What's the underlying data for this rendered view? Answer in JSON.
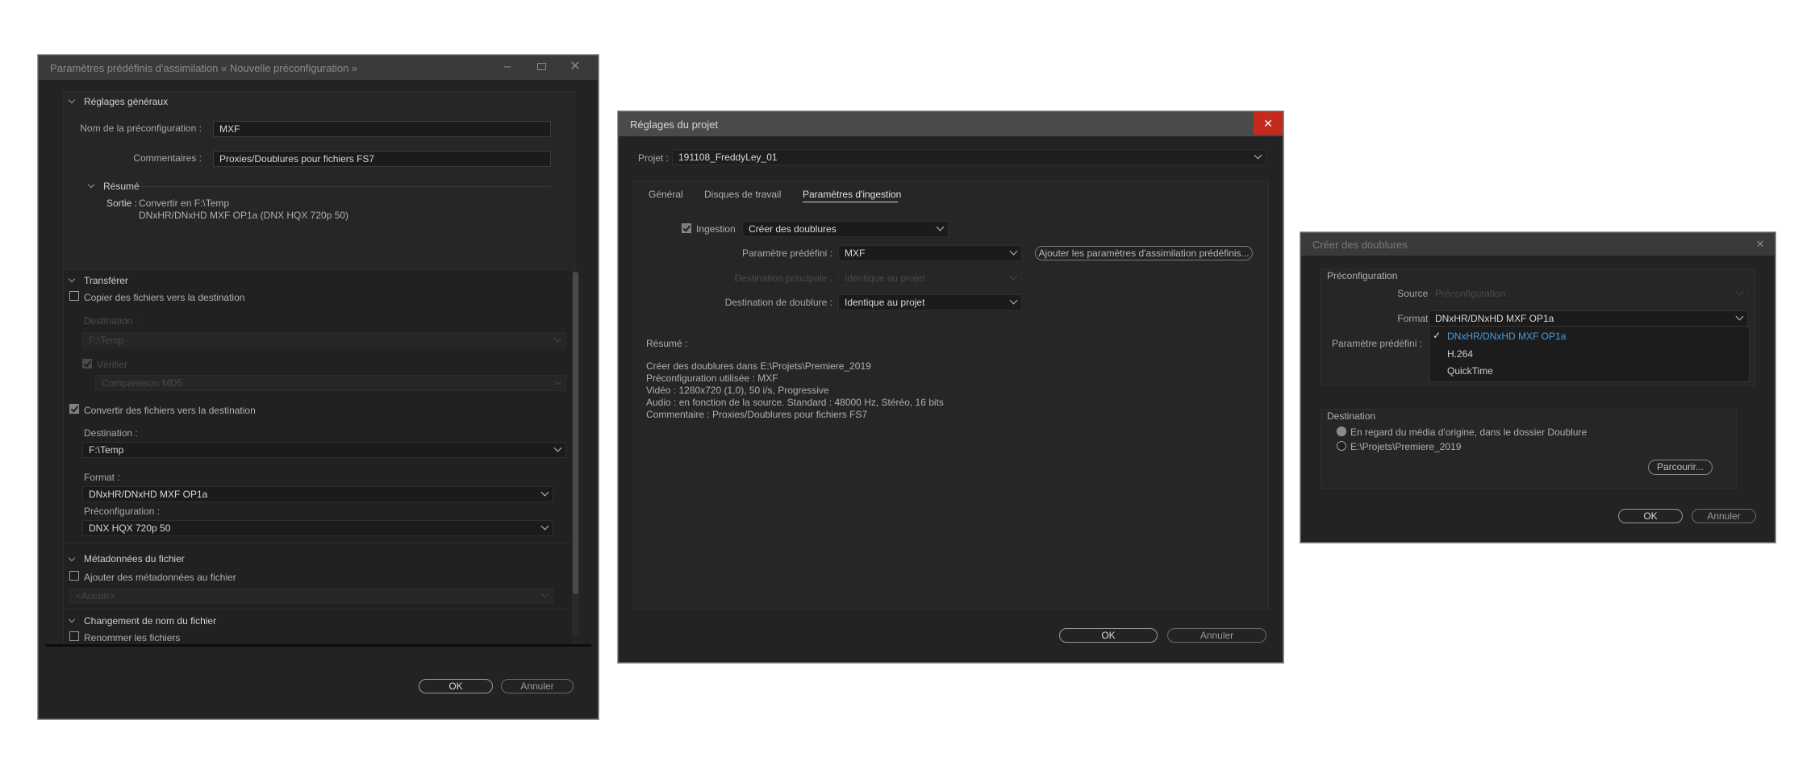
{
  "w1": {
    "title": "Paramètres prédéfinis d'assimilation « Nouvelle préconfiguration »",
    "general": {
      "header": "Réglages généraux",
      "name_label": "Nom de la préconfiguration :",
      "name_value": "MXF",
      "comments_label": "Commentaires :",
      "comments_value": "Proxies/Doublures pour fichiers FS7",
      "summary_header": "Résumé",
      "output_label": "Sortie :",
      "output_line1": "Convertir en F:\\Temp",
      "output_line2": "DNxHR/DNxHD MXF OP1a (DNX HQX 720p 50)"
    },
    "transfer": {
      "header": "Transférer",
      "copy_label": "Copier des fichiers vers la destination",
      "dest_label": "Destination :",
      "dest_value": "F:\\Temp",
      "verify_label": "Vérifier",
      "verify_method": "Comparaison MD5",
      "convert_label": "Convertir des fichiers vers la destination",
      "dest2_label": "Destination :",
      "dest2_value": "F:\\Temp",
      "format_label": "Format :",
      "format_value": "DNxHR/DNxHD MXF OP1a",
      "preset_label": "Préconfiguration :",
      "preset_value": "DNX HQX 720p 50"
    },
    "metadata": {
      "header": "Métadonnées du fichier",
      "add_label": "Ajouter des métadonnées au fichier",
      "none_value": "<Aucun>"
    },
    "rename": {
      "header": "Changement de nom du fichier",
      "rename_label": "Renommer les fichiers"
    },
    "ok": "OK",
    "cancel": "Annuler"
  },
  "w2": {
    "title": "Réglages du projet",
    "project_label": "Projet :",
    "project_value": "191108_FreddyLey_01",
    "tabs": [
      "Général",
      "Disques de travail",
      "Paramètres d'ingestion"
    ],
    "ingest_label": "Ingestion",
    "ingest_value": "Créer des doublures",
    "preset_label": "Paramètre prédéfini :",
    "preset_value": "MXF",
    "add_presets": "Ajouter les paramètres d'assimilation prédéfinis...",
    "primary_label": "Destination principale :",
    "primary_value": "Identique au projet",
    "proxy_label": "Destination de doublure :",
    "proxy_value": "Identique au projet",
    "summary_title": "Résumé :",
    "summary_lines": [
      "Créer des doublures dans E:\\Projets\\Premiere_2019",
      "Préconfiguration  utilisée : MXF",
      "Vidéo : 1280x720 (1,0), 50 i/s, Progressive",
      "Audio : en fonction de la source. Standard : 48000  Hz, Stéréo, 16 bits",
      "Commentaire : Proxies/Doublures pour fichiers FS7"
    ],
    "ok": "OK",
    "cancel": "Annuler"
  },
  "w3": {
    "title": "Créer des doublures",
    "preconfig_header": "Préconfiguration",
    "source_label": "Source :",
    "source_value": "Préconfiguration",
    "format_label": "Format :",
    "format_value": "DNxHR/DNxHD MXF OP1a",
    "preset_label": "Paramètre prédéfini :",
    "format_options": [
      "DNxHR/DNxHD MXF OP1a",
      "H.264",
      "QuickTime"
    ],
    "selected_color": "#4a9de0",
    "destination_header": "Destination",
    "radio1": "En regard du média d'origine, dans le dossier Doublure",
    "radio2": "E:\\Projets\\Premiere_2019",
    "browse": "Parcourir...",
    "ok": "OK",
    "cancel": "Annuler"
  }
}
